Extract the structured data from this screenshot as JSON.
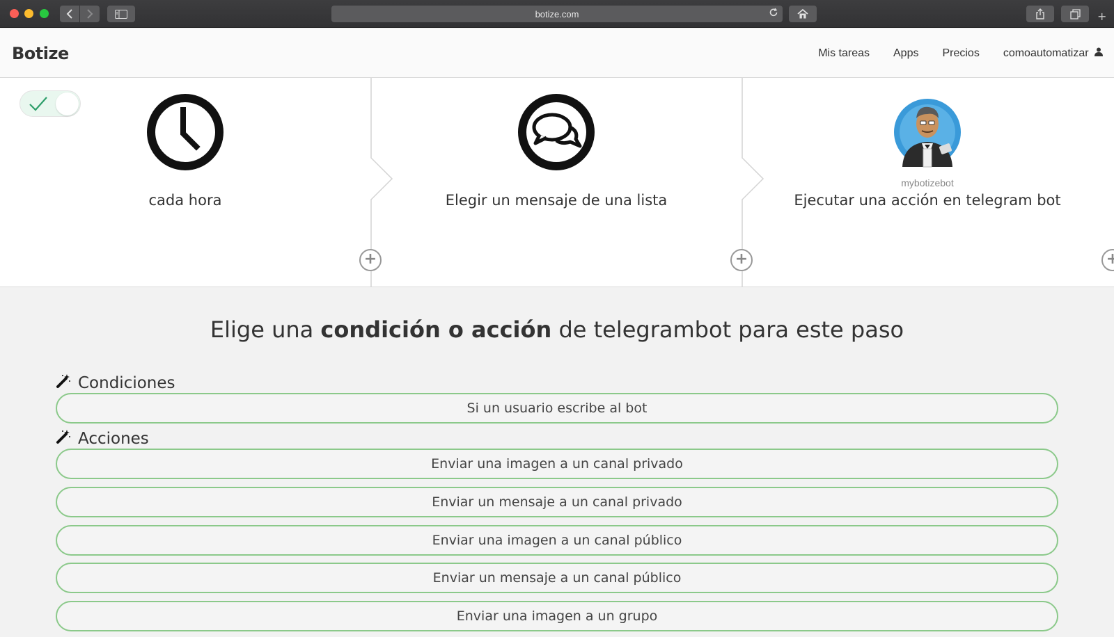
{
  "browser": {
    "url": "botize.com",
    "icons": [
      "back-icon",
      "forward-icon",
      "sidebar-icon",
      "reload-icon",
      "home-icon",
      "share-icon",
      "tabs-icon",
      "new-tab-icon"
    ]
  },
  "header": {
    "logo": "Botize",
    "nav": [
      "Mis tareas",
      "Apps",
      "Precios"
    ],
    "user": "comoautomatizar"
  },
  "steps": [
    {
      "label": "cada hora",
      "icon": "clock-icon"
    },
    {
      "label": "Elegir un mensaje de una lista",
      "icon": "chat-icon"
    },
    {
      "label": "Ejecutar una acción en telegram bot",
      "sublabel": "mybotizebot",
      "icon": "bot-avatar-icon"
    }
  ],
  "toggle": {
    "enabled": true
  },
  "chooser": {
    "title_pre": "Elige una ",
    "title_bold": "condición o acción",
    "title_post": " de telegrambot para este paso"
  },
  "conditions": {
    "heading": "Condiciones",
    "items": [
      "Si un usuario escribe al bot"
    ]
  },
  "actions": {
    "heading": "Acciones",
    "items": [
      "Enviar una imagen a un canal privado",
      "Enviar un mensaje a un canal privado",
      "Enviar una imagen a un canal público",
      "Enviar un mensaje a un canal público",
      "Enviar una imagen a un grupo"
    ]
  },
  "colors": {
    "option_border": "#8bc98a",
    "toggle_check": "#2e9e6a"
  }
}
